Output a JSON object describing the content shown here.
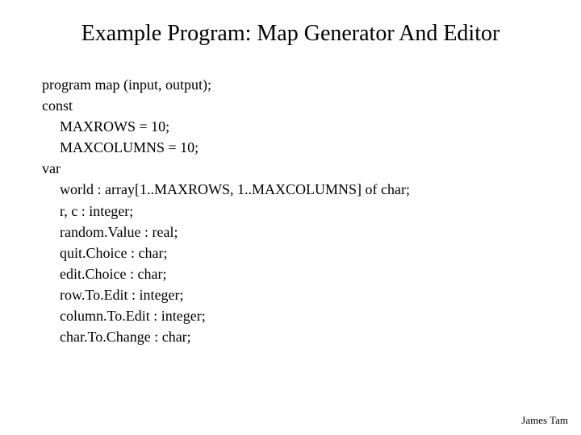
{
  "title": "Example Program: Map Generator And Editor",
  "code": {
    "l1": "program map (input, output);",
    "l2": "const",
    "l3": "MAXROWS    = 10;",
    "l4": "MAXCOLUMNS =  10;",
    "l5": "var",
    "l6": "world                : array[1..MAXROWS, 1..MAXCOLUMNS] of char;",
    "l7": "r, c                    : integer;",
    "l8": "random.Value  : real;",
    "l9": "quit.Choice      : char;",
    "l10": "edit.Choice       : char;",
    "l11": "row.To.Edit       : integer;",
    "l12": "column.To.Edit : integer;",
    "l13": "char.To.Change : char;"
  },
  "footer": "James Tam"
}
